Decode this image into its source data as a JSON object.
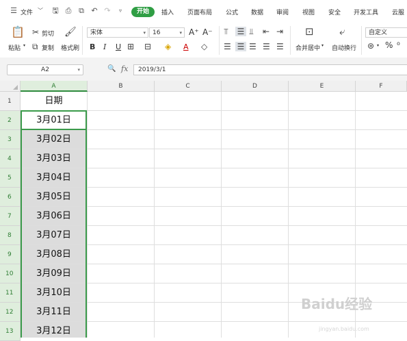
{
  "menubar": {
    "file_label": "文件",
    "tabs": [
      "开始",
      "插入",
      "页面布局",
      "公式",
      "数据",
      "审阅",
      "视图",
      "安全",
      "开发工具",
      "云服"
    ]
  },
  "ribbon": {
    "paste_label": "粘贴",
    "cut_label": "剪切",
    "copy_label": "复制",
    "format_painter_label": "格式刷",
    "font_name": "宋体",
    "font_size": "16",
    "merge_center_label": "合并居中",
    "wrap_text_label": "自动换行",
    "number_format": "自定义"
  },
  "formula_bar": {
    "name_box": "A2",
    "fx_label": "fx",
    "value": "2019/3/1"
  },
  "columns": [
    "A",
    "B",
    "C",
    "D",
    "E",
    "F"
  ],
  "rows": [
    "1",
    "2",
    "3",
    "4",
    "5",
    "6",
    "7",
    "8",
    "9",
    "10",
    "11",
    "12",
    "13"
  ],
  "cells_A": [
    "日期",
    "3月01日",
    "3月02日",
    "3月03日",
    "3月04日",
    "3月05日",
    "3月06日",
    "3月07日",
    "3月08日",
    "3月09日",
    "3月10日",
    "3月11日",
    "3月12日"
  ],
  "watermark": {
    "text": "Baidu经验",
    "sub": "jingyan.baidu.com"
  },
  "colors": {
    "accent": "#2f9e44",
    "selection_border": "#3a9a4a",
    "selected_fill": "#dcdcdc"
  }
}
